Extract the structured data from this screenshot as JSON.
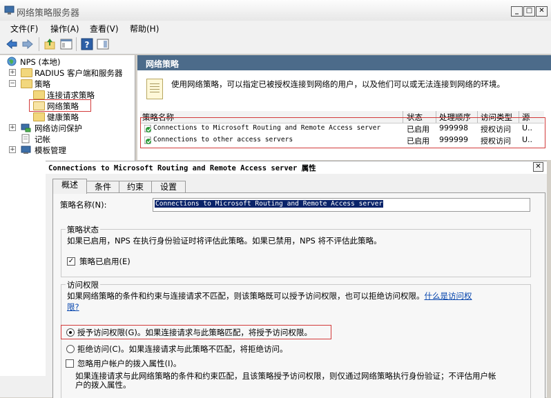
{
  "window": {
    "title": "网络策略服务器",
    "min": "_",
    "max": "□",
    "close": "✕"
  },
  "menu": [
    "文件(F)",
    "操作(A)",
    "查看(V)",
    "帮助(H)"
  ],
  "tree": {
    "root": "NPS (本地)",
    "radius": "RADIUS 客户端和服务器",
    "policies": "策略",
    "conn_req": "连接请求策略",
    "network": "网络策略",
    "health": "健康策略",
    "nap": "网络访问保护",
    "accounting": "记帐",
    "templates": "模板管理"
  },
  "right_pane": {
    "header": "网络策略",
    "description": "使用网络策略，可以指定已被授权连接到网络的用户，以及他们可以或无法连接到网络的环境。",
    "columns": [
      "策略名称",
      "状态",
      "处理顺序",
      "访问类型",
      "源"
    ],
    "rows": [
      {
        "name": "Connections to Microsoft Routing and Remote Access server",
        "status": "已启用",
        "order": "999998",
        "access": "授权访问",
        "source": "U.."
      },
      {
        "name": "Connections to other access servers",
        "status": "已启用",
        "order": "999999",
        "access": "授权访问",
        "source": "U.."
      }
    ]
  },
  "dialog": {
    "title_policy": "Connections to Microsoft Routing and Remote Access server",
    "title_suffix": "属性",
    "close": "✕",
    "tabs": [
      "概述",
      "条件",
      "约束",
      "设置"
    ],
    "policy_name_label": "策略名称(N):",
    "policy_name_value": "Connections to Microsoft Routing and Remote Access server",
    "state_group": "策略状态",
    "state_desc": "如果已启用，NPS 在执行身份验证时将评估此策略。如果已禁用，NPS 将不评估此策略。",
    "enabled_label": "策略已启用(E)",
    "enabled_checked": "✓",
    "access_group": "访问权限",
    "access_desc": "如果网络策略的条件和约束与连接请求不匹配，则该策略既可以授予访问权限，也可以拒绝访问权限。",
    "access_link_1": "什么是访问权",
    "access_link_2": "限?",
    "grant_label": "授予访问权限(G)。如果连接请求与此策略匹配，将授予访问权限。",
    "deny_label": "拒绝访问(C)。如果连接请求与此策略不匹配，将拒绝访问。",
    "ignore_label": "忽略用户帐户的拨入属性(I)。",
    "ignore_desc_1": "如果连接请求与此网络策略的条件和约束匹配，且该策略授予访问权限，则仅通过网络策略执行身份验证；不评估用户帐",
    "ignore_desc_2": "户的拨入属性。"
  },
  "colors": {
    "pane_header": "#4c6b8a",
    "highlight_box": "#d23a3a",
    "selection": "#0a246a"
  }
}
